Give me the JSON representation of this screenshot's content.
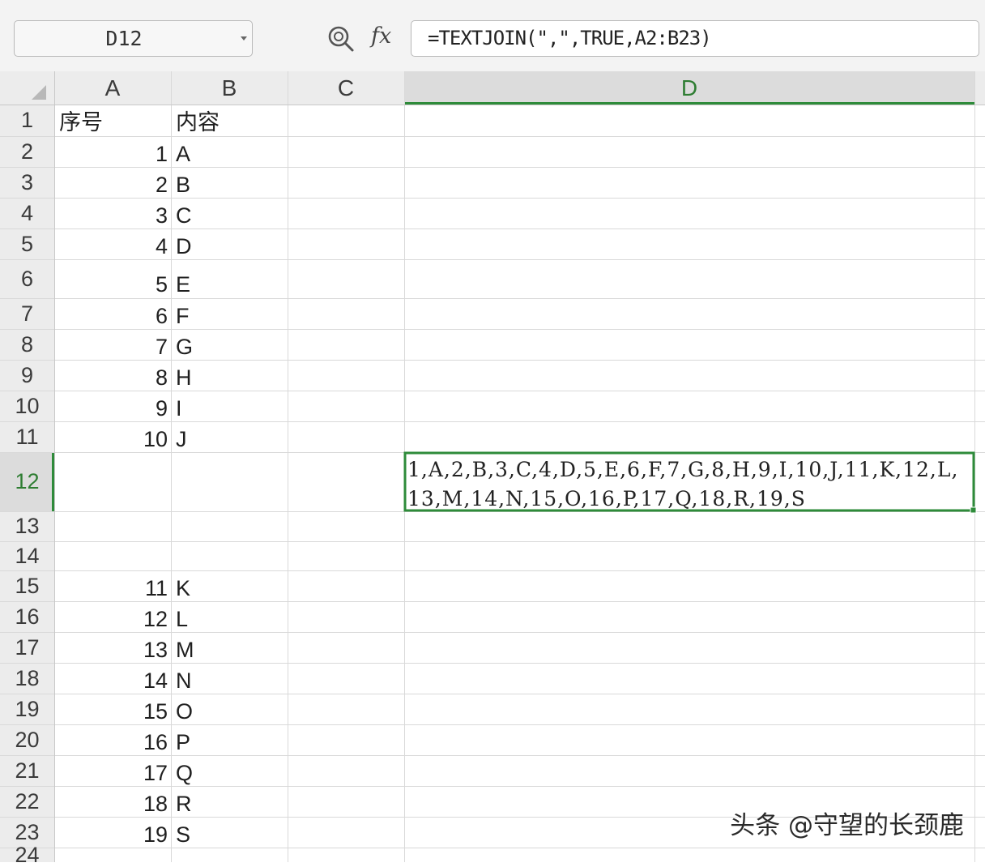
{
  "formula_bar": {
    "name_box": "D12",
    "fx_label": "fx",
    "formula": "=TEXTJOIN(\",\",TRUE,A2:B23)"
  },
  "columns": [
    "A",
    "B",
    "C",
    "D"
  ],
  "rows": [
    "1",
    "2",
    "3",
    "4",
    "5",
    "6",
    "7",
    "8",
    "9",
    "10",
    "11",
    "12",
    "13",
    "14",
    "15",
    "16",
    "17",
    "18",
    "19",
    "20",
    "21",
    "22",
    "23",
    "24"
  ],
  "headers": {
    "a": "序号",
    "b": "内容"
  },
  "data_rows": [
    {
      "row": "2",
      "a": "1",
      "b": "A"
    },
    {
      "row": "3",
      "a": "2",
      "b": "B"
    },
    {
      "row": "4",
      "a": "3",
      "b": "C"
    },
    {
      "row": "5",
      "a": "4",
      "b": "D"
    },
    {
      "row": "6",
      "a": "5",
      "b": "E"
    },
    {
      "row": "7",
      "a": "6",
      "b": "F"
    },
    {
      "row": "8",
      "a": "7",
      "b": "G"
    },
    {
      "row": "9",
      "a": "8",
      "b": "H"
    },
    {
      "row": "10",
      "a": "9",
      "b": "I"
    },
    {
      "row": "11",
      "a": "10",
      "b": "J"
    },
    {
      "row": "15",
      "a": "11",
      "b": "K"
    },
    {
      "row": "16",
      "a": "12",
      "b": "L"
    },
    {
      "row": "17",
      "a": "13",
      "b": "M"
    },
    {
      "row": "18",
      "a": "14",
      "b": "N"
    },
    {
      "row": "19",
      "a": "15",
      "b": "O"
    },
    {
      "row": "20",
      "a": "16",
      "b": "P"
    },
    {
      "row": "21",
      "a": "17",
      "b": "Q"
    },
    {
      "row": "22",
      "a": "18",
      "b": "R"
    },
    {
      "row": "23",
      "a": "19",
      "b": "S"
    }
  ],
  "selected_cell": {
    "ref": "D12",
    "value": "1,A,2,B,3,C,4,D,5,E,6,F,7,G,8,H,9,I,10,J,11,K,12,L,13,M,14,N,15,O,16,P,17,Q,18,R,19,S"
  },
  "watermark": "头条 @守望的长颈鹿",
  "colors": {
    "selection": "#2e8b3a",
    "header_bg": "#ececec",
    "active_header_bg": "#dcdcdc",
    "gridline": "#d9d9d9"
  }
}
